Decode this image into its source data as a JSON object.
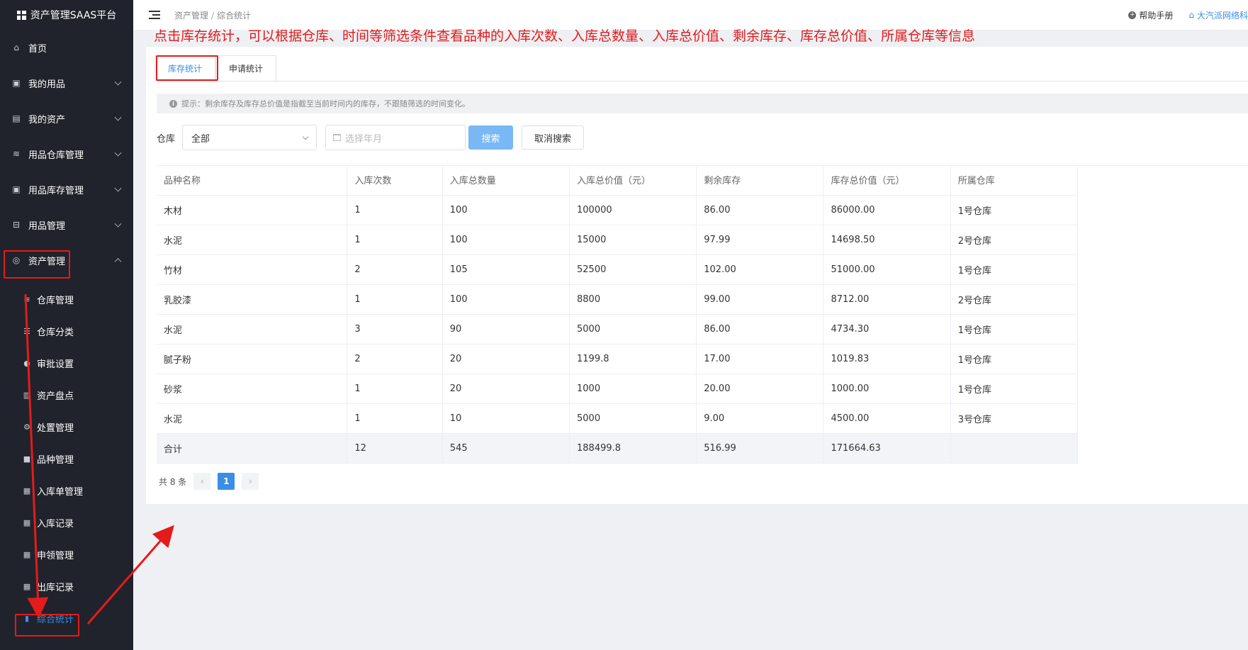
{
  "app": {
    "title": "资产管理SAAS平台"
  },
  "sidebar": {
    "items": [
      {
        "label": "首页",
        "icon": "home-icon"
      },
      {
        "label": "我的用品",
        "icon": "package-icon"
      },
      {
        "label": "我的资产",
        "icon": "building-icon"
      },
      {
        "label": "用品仓库管理",
        "icon": "database-icon"
      },
      {
        "label": "用品库存管理",
        "icon": "package-icon"
      },
      {
        "label": "用品管理",
        "icon": "inbox-icon"
      },
      {
        "label": "资产管理",
        "icon": "assets-icon"
      }
    ],
    "subitems": [
      {
        "label": "仓库管理",
        "icon": "database-icon"
      },
      {
        "label": "仓库分类",
        "icon": "list-icon"
      },
      {
        "label": "审批设置",
        "icon": "user-icon"
      },
      {
        "label": "资产盘点",
        "icon": "document-icon"
      },
      {
        "label": "处置管理",
        "icon": "gear-icon"
      },
      {
        "label": "品种管理",
        "icon": "lock-icon"
      },
      {
        "label": "入库单管理",
        "icon": "clipboard-icon"
      },
      {
        "label": "入库记录",
        "icon": "clipboard-icon"
      },
      {
        "label": "申领管理",
        "icon": "clipboard-icon"
      },
      {
        "label": "出库记录",
        "icon": "clipboard-icon"
      },
      {
        "label": "综合统计",
        "icon": "bar-chart-icon"
      }
    ]
  },
  "header": {
    "breadcrumb": [
      "资产管理",
      "综合统计"
    ],
    "help": "帮助手册",
    "company": "大汽派网络科"
  },
  "annotation": "点击库存统计，可以根据仓库、时间等筛选条件查看品种的入库次数、入库总数量、入库总价值、剩余库存、库存总价值、所属仓库等信息",
  "tabs": [
    {
      "label": "库存统计"
    },
    {
      "label": "申请统计"
    }
  ],
  "hint": "提示：剩余库存及库存总价值是指截至当前时间内的库存，不跟随筛选的时间变化。",
  "filters": {
    "warehouse_label": "仓库",
    "warehouse_value": "全部",
    "date_placeholder": "选择年月",
    "search": "搜索",
    "cancel": "取消搜索"
  },
  "table": {
    "columns": [
      "品种名称",
      "入库次数",
      "入库总数量",
      "入库总价值（元）",
      "剩余库存",
      "库存总价值（元）",
      "所属仓库"
    ],
    "rows": [
      [
        "木材",
        "1",
        "100",
        "100000",
        "86.00",
        "86000.00",
        "1号仓库"
      ],
      [
        "水泥",
        "1",
        "100",
        "15000",
        "97.99",
        "14698.50",
        "2号仓库"
      ],
      [
        "竹材",
        "2",
        "105",
        "52500",
        "102.00",
        "51000.00",
        "1号仓库"
      ],
      [
        "乳胶漆",
        "1",
        "100",
        "8800",
        "99.00",
        "8712.00",
        "2号仓库"
      ],
      [
        "水泥",
        "3",
        "90",
        "5000",
        "86.00",
        "4734.30",
        "1号仓库"
      ],
      [
        "腻子粉",
        "2",
        "20",
        "1199.8",
        "17.00",
        "1019.83",
        "1号仓库"
      ],
      [
        "砂浆",
        "1",
        "20",
        "1000",
        "20.00",
        "1000.00",
        "1号仓库"
      ],
      [
        "水泥",
        "1",
        "10",
        "5000",
        "9.00",
        "4500.00",
        "3号仓库"
      ]
    ],
    "total": [
      "合计",
      "12",
      "545",
      "188499.8",
      "516.99",
      "171664.63",
      ""
    ]
  },
  "pagination": {
    "total": "共 8 条",
    "prev": "‹",
    "current": "1",
    "next": "›"
  },
  "colors": {
    "accent": "#3a8ee6",
    "annotation_red": "#e41b1b",
    "sidebar_bg": "#20232b"
  }
}
